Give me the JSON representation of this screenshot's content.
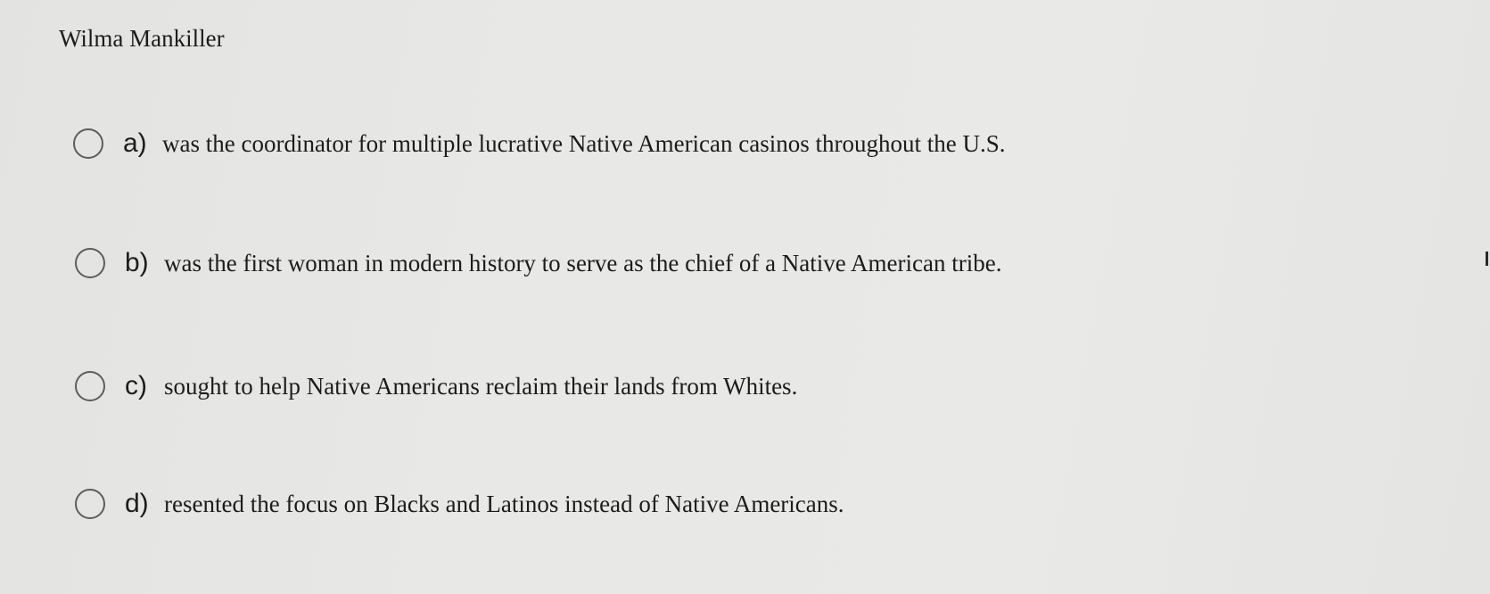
{
  "question": {
    "title": "Wilma Mankiller"
  },
  "options": [
    {
      "letter": "a)",
      "text": "was the coordinator for multiple lucrative Native American casinos throughout the U.S.",
      "selected": false
    },
    {
      "letter": "b)",
      "text": "was the first woman in modern history to serve as the chief of a Native American tribe.",
      "selected": false
    },
    {
      "letter": "c)",
      "text": "sought to help Native Americans reclaim their lands from Whites.",
      "selected": false
    },
    {
      "letter": "d)",
      "text": "resented the focus on Blacks and Latinos instead of Native Americans.",
      "selected": false
    }
  ],
  "colors": {
    "text": "#1c1c1c",
    "radio_border": "#5d5d5d",
    "background": "#e8e8e6"
  }
}
